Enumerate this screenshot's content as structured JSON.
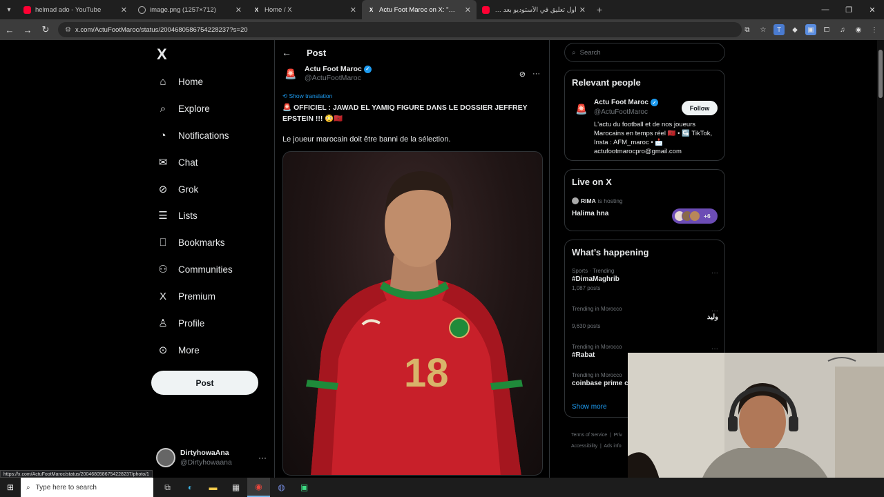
{
  "browser": {
    "tabs": [
      {
        "title": "helmad ado - YouTube",
        "icon": "youtube-icon",
        "active": false
      },
      {
        "title": "image.png (1257×712)",
        "icon": "image-icon",
        "active": false
      },
      {
        "title": "Home / X",
        "icon": "x-logo-icon",
        "active": false
      },
      {
        "title": "Actu Foot Maroc on X: \"🚨 OFFI",
        "icon": "x-logo-icon",
        "active": true
      },
      {
        "title": "أول تعليق في الأستوديو بعد تعادل",
        "icon": "youtube-icon",
        "active": false
      }
    ],
    "url": "x.com/ActuFootMaroc/status/2004680586754228237?s=20",
    "status_url": "https://x.com/ActuFootMaroc/status/2004680586754228237/photo/1"
  },
  "nav": {
    "items": [
      {
        "label": "Home",
        "icon": "home-icon",
        "glyph": "⌂"
      },
      {
        "label": "Explore",
        "icon": "search-icon",
        "glyph": "⌕"
      },
      {
        "label": "Notifications",
        "icon": "bell-icon",
        "glyph": "◔"
      },
      {
        "label": "Chat",
        "icon": "mail-icon",
        "glyph": "✉"
      },
      {
        "label": "Grok",
        "icon": "grok-icon",
        "glyph": "⊘"
      },
      {
        "label": "Lists",
        "icon": "list-icon",
        "glyph": "☰"
      },
      {
        "label": "Bookmarks",
        "icon": "bookmark-icon",
        "glyph": "⎕"
      },
      {
        "label": "Communities",
        "icon": "communities-icon",
        "glyph": "⚇"
      },
      {
        "label": "Premium",
        "icon": "x-logo-icon",
        "glyph": "X"
      },
      {
        "label": "Profile",
        "icon": "profile-icon",
        "glyph": "♙"
      },
      {
        "label": "More",
        "icon": "more-circle-icon",
        "glyph": "⊙"
      }
    ],
    "post_label": "Post",
    "account": {
      "name": "DirtyhowaAna",
      "handle": "@Dirtyhowaana"
    }
  },
  "post": {
    "header": "Post",
    "author_name": "Actu Foot Maroc",
    "author_handle": "@ActuFootMaroc",
    "show_translation": "Show translation",
    "text": "🚨 OFFICIEL : JAWAD EL YAMIQ FIGURE DANS LE DOSSIER JEFFREY EPSTEIN !!! 😳🇲🇦",
    "text2": "Le joueur marocain doit être banni de la sélection.",
    "jersey_number": "18"
  },
  "sidebar": {
    "search_placeholder": "Search",
    "relevant": {
      "title": "Relevant people",
      "name": "Actu Foot Maroc",
      "handle": "@ActuFootMaroc",
      "follow": "Follow",
      "bio": "L'actu du football et de nos joueurs Marocains en temps réel 🇲🇦 • ↪️ TikTok, Insta : AFM_maroc • 📩 actufootmarocpro@gmail.com"
    },
    "live": {
      "title": "Live on X",
      "host": "RIMA",
      "hosting": "is hosting",
      "space": "Halima hna",
      "count": "+6"
    },
    "happening": {
      "title": "What’s happening",
      "trends": [
        {
          "meta": "Sports · Trending",
          "name": "#DimaMaghrib",
          "count": "1,087 posts"
        },
        {
          "meta": "Trending in Morocco",
          "name": "وليد",
          "count": "9,630 posts"
        },
        {
          "meta": "Trending in Morocco",
          "name": "#Rabat",
          "count": ""
        },
        {
          "meta": "Trending in Morocco",
          "name": "coinbase prime c",
          "count": ""
        }
      ],
      "show_more": "Show more"
    },
    "footer": [
      "Terms of Service",
      "Priv",
      "Accessibility",
      "Ads info"
    ]
  },
  "taskbar": {
    "search_placeholder": "Type here to search"
  },
  "colors": {
    "accent": "#1d9bf0",
    "background": "#000000",
    "jersey": "#c8202a"
  }
}
